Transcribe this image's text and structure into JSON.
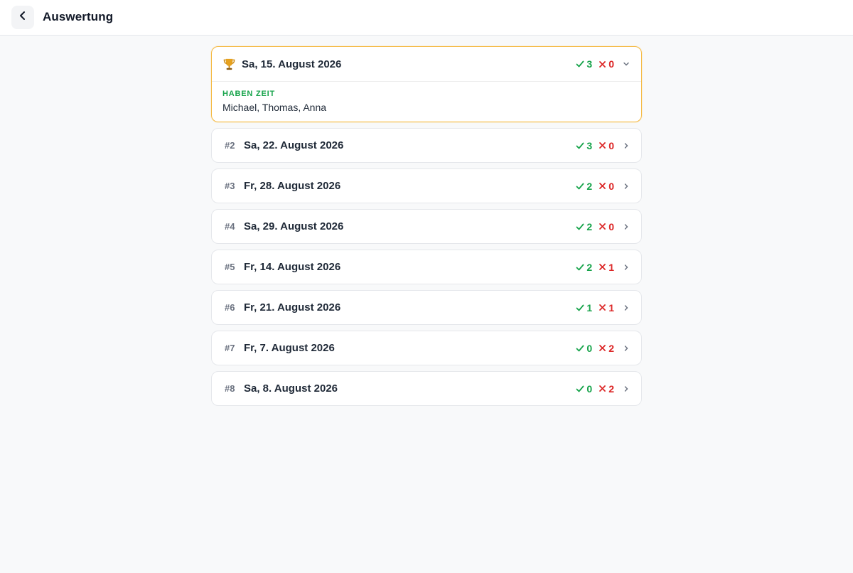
{
  "header": {
    "title": "Auswertung",
    "back_icon": "chevron-left-icon"
  },
  "winner": {
    "icon": "trophy-icon",
    "date": "Sa, 15. August 2026",
    "yes": "3",
    "no": "0",
    "expanded_label": "HABEN ZEIT",
    "names": "Michael, Thomas, Anna"
  },
  "items": [
    {
      "rank": "#2",
      "date": "Sa, 22. August 2026",
      "yes": "3",
      "no": "0"
    },
    {
      "rank": "#3",
      "date": "Fr, 28. August 2026",
      "yes": "2",
      "no": "0"
    },
    {
      "rank": "#4",
      "date": "Sa, 29. August 2026",
      "yes": "2",
      "no": "0"
    },
    {
      "rank": "#5",
      "date": "Fr, 14. August 2026",
      "yes": "2",
      "no": "1"
    },
    {
      "rank": "#6",
      "date": "Fr, 21. August 2026",
      "yes": "1",
      "no": "1"
    },
    {
      "rank": "#7",
      "date": "Fr, 7. August 2026",
      "yes": "0",
      "no": "2"
    },
    {
      "rank": "#8",
      "date": "Sa, 8. August 2026",
      "yes": "0",
      "no": "2"
    }
  ],
  "colors": {
    "yes": "#16a34a",
    "no": "#dc2626",
    "winner_border": "#f5b942"
  }
}
